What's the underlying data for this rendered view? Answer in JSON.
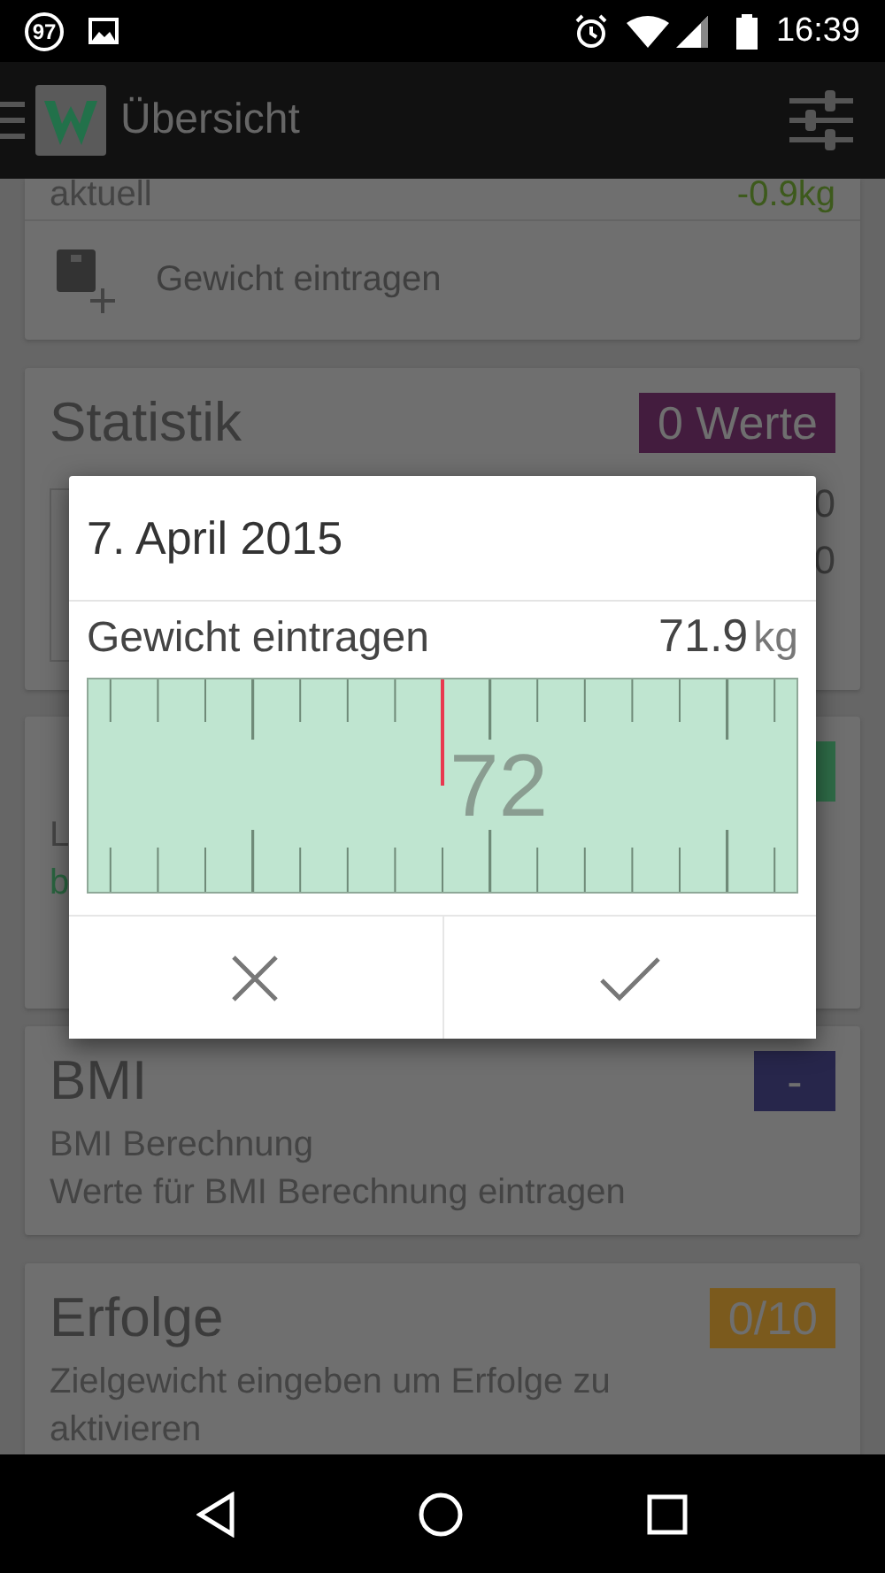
{
  "status_bar": {
    "notification_count": "97",
    "time": "16:39"
  },
  "app_bar": {
    "title": "Übersicht"
  },
  "cards": [
    {
      "kind": "weight",
      "label": "aktuell",
      "change": "-0.9kg",
      "action": "Gewicht eintragen"
    },
    {
      "kind": "stats",
      "title": "Statistik",
      "badge": "0 Werte",
      "color": "#431c3e",
      "values": [
        "0",
        "0"
      ]
    },
    {
      "kind": "info",
      "color": "#2e6b47",
      "lines": [
        {
          "text": "L",
          "highlight": false
        },
        {
          "text": "b",
          "highlight": true
        }
      ]
    },
    {
      "kind": "info",
      "title": "BMI",
      "badge": "-",
      "color": "#27264b",
      "lines": [
        {
          "text": "BMI Berechnung",
          "highlight": false
        },
        {
          "text": "Werte für BMI Berechnung eintragen",
          "highlight": false
        }
      ]
    },
    {
      "kind": "info",
      "title": "Erfolge",
      "badge": "0/10",
      "color": "#7b5a1d",
      "lines": [
        {
          "text": "Zielgewicht eingeben um Erfolge zu aktivieren",
          "highlight": false
        }
      ]
    }
  ],
  "dialog": {
    "title": "7. April 2015",
    "label": "Gewicht eintragen",
    "value": "71.9",
    "unit": "kg",
    "scale_label": "72"
  }
}
